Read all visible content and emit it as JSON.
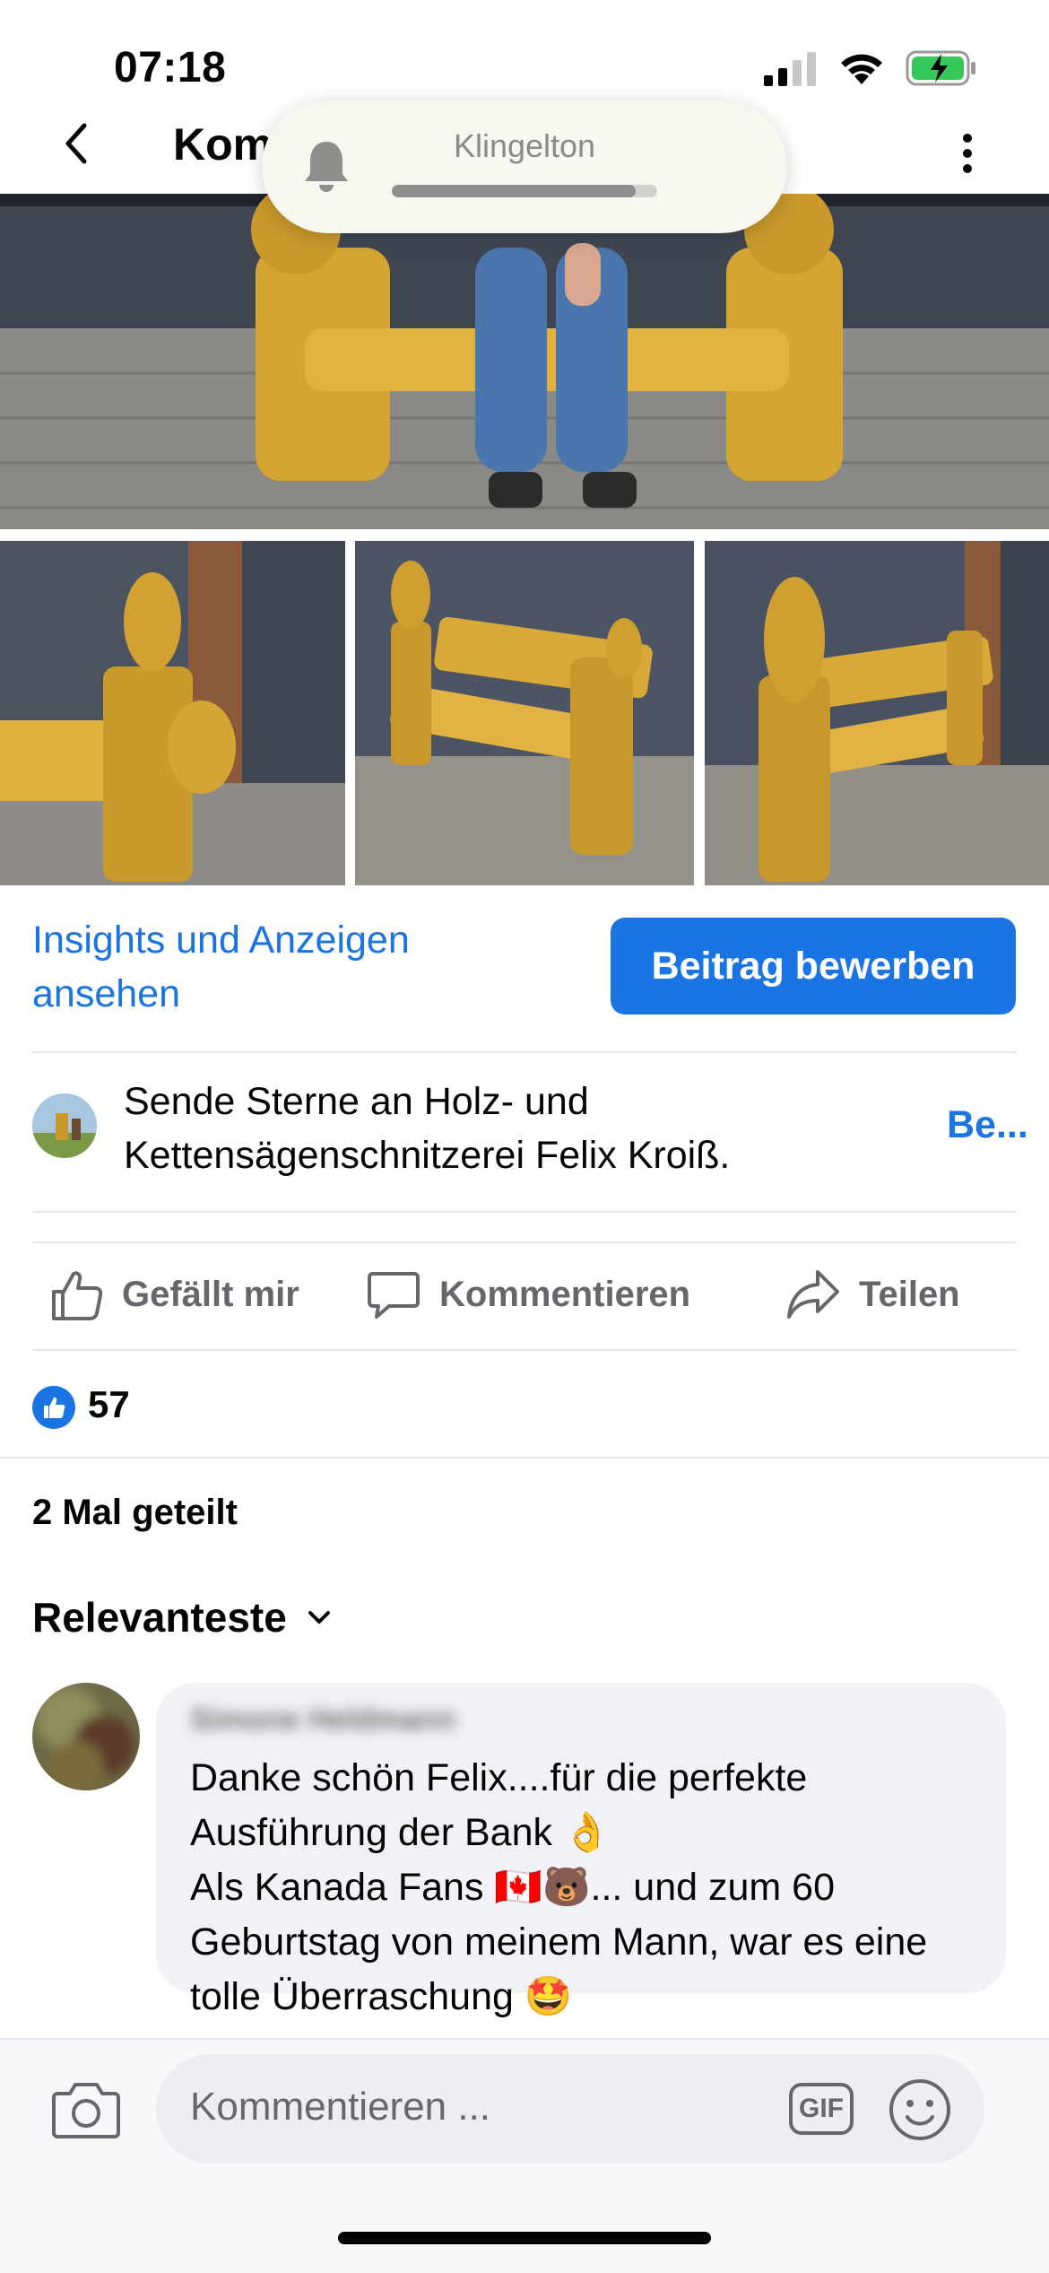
{
  "status_bar": {
    "time": "07:18"
  },
  "nav": {
    "title": "Kom"
  },
  "ringer": {
    "label": "Klingelton",
    "level": 0.92
  },
  "post": {
    "insights_link": "Insights und Anzeigen ansehen",
    "promote_button": "Beitrag bewerben",
    "stars_text": "Sende Sterne an Holz- und Kettensägenschnitzerei Felix Kroiß.",
    "stars_link": "Be..."
  },
  "actions": {
    "like": "Gefällt mir",
    "comment": "Kommentieren",
    "share": "Teilen"
  },
  "reactions": {
    "count": "57"
  },
  "shares": "2 Mal geteilt",
  "sort": {
    "label": "Relevanteste"
  },
  "comment": {
    "author": "Simone Heldmann",
    "line1": "Danke schön Felix....für die perfekte",
    "line2": "Ausführung der Bank 👌",
    "line3": "Als Kanada Fans 🇨🇦🐻... und zum 60",
    "line4": "Geburtstag von meinem Mann, war es eine",
    "line5": "tolle Überraschung 🤩"
  },
  "composer": {
    "placeholder": "Kommentieren ...",
    "gif": "GIF"
  },
  "colors": {
    "accent": "#1b74e4",
    "secondary_text": "#65676b",
    "bubble": "#f0f2f5"
  }
}
